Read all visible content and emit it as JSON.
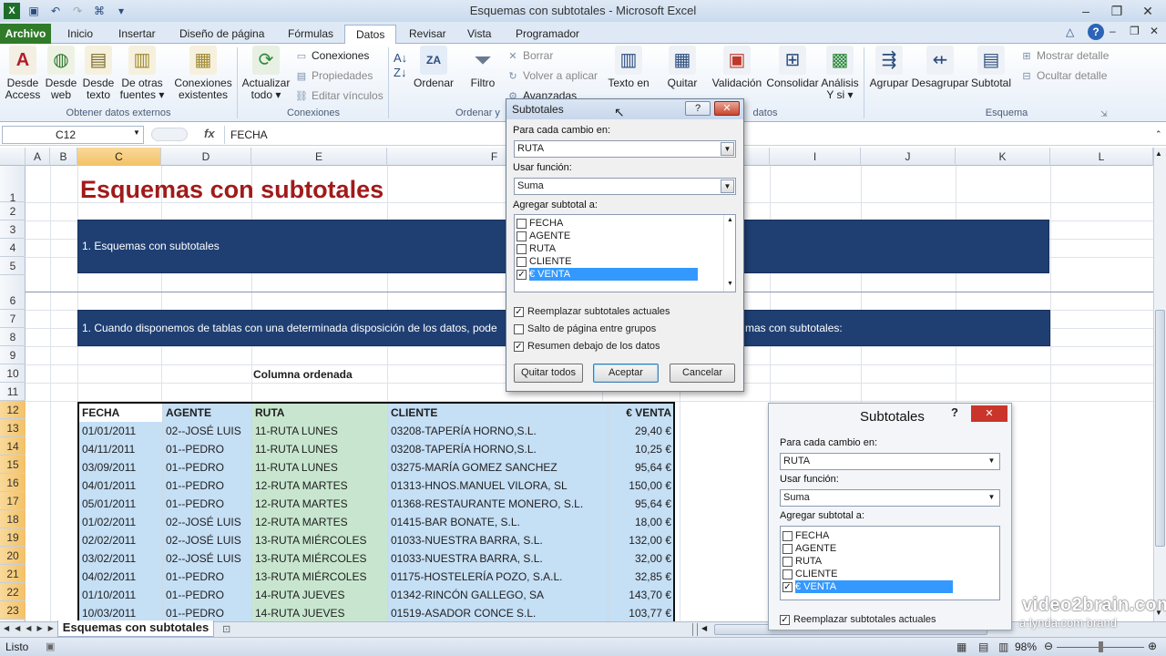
{
  "window": {
    "title": "Esquemas con subtotales - Microsoft Excel"
  },
  "tabs": [
    "Archivo",
    "Inicio",
    "Insertar",
    "Diseño de página",
    "Fórmulas",
    "Datos",
    "Revisar",
    "Vista",
    "Programador"
  ],
  "ribbon": {
    "desde_access": [
      "Desde",
      "Access"
    ],
    "desde_web": [
      "Desde",
      "web"
    ],
    "desde_texto": [
      "Desde",
      "texto"
    ],
    "otras_fuentes": [
      "De otras",
      "fuentes ▾"
    ],
    "conexiones_existentes": [
      "Conexiones",
      "existentes"
    ],
    "group_obtener": "Obtener datos externos",
    "actualizar": [
      "Actualizar",
      "todo ▾"
    ],
    "conexiones": "Conexiones",
    "propiedades": "Propiedades",
    "editar_vinculos": "Editar vínculos",
    "group_conexiones": "Conexiones",
    "ordenar": "Ordenar",
    "filtro": "Filtro",
    "borrar": "Borrar",
    "volver_aplicar": "Volver a aplicar",
    "avanzadas": "Avanzadas",
    "group_ordenar": "Ordenar y",
    "texto_en": "Texto en",
    "quitar": "Quitar",
    "validacion": "Validación",
    "consolidar": "Consolidar",
    "analisis": [
      "Análisis",
      "Y si ▾"
    ],
    "group_datos": "datos",
    "agrupar": "Agrupar",
    "desagrupar": "Desagrupar",
    "subtotal": "Subtotal",
    "mostrar_detalle": "Mostrar detalle",
    "ocultar_detalle": "Ocultar detalle",
    "group_esquema": "Esquema"
  },
  "formula_bar": {
    "cell": "C12",
    "fx": "fx",
    "value": "FECHA"
  },
  "columns": [
    "A",
    "B",
    "C",
    "D",
    "E",
    "F",
    "G",
    "H",
    "I",
    "J",
    "K",
    "L"
  ],
  "rows": [
    "1",
    "2",
    "3",
    "4",
    "5",
    "6",
    "7",
    "8",
    "9",
    "10",
    "11",
    "12",
    "13",
    "14",
    "15",
    "16",
    "17",
    "18",
    "19",
    "20",
    "21",
    "22",
    "23"
  ],
  "sheet": {
    "title": "Esquemas con subtotales",
    "bar1": "1. Esquemas con subtotales",
    "bar2_left": "1. Cuando disponemos de tablas con una determinada disposición de los datos, pode",
    "bar2_right": "mas con subtotales:",
    "columna_ordenada": "Columna ordenada"
  },
  "table": {
    "headers": [
      "FECHA",
      "AGENTE",
      "RUTA",
      "CLIENTE",
      "€ VENTA"
    ],
    "rows": [
      [
        "01/01/2011",
        "02--JOSÉ LUIS",
        "11-RUTA LUNES",
        "03208-TAPERÍA HORNO,S.L.",
        "29,40 €"
      ],
      [
        "04/11/2011",
        "01--PEDRO",
        "11-RUTA LUNES",
        "03208-TAPERÍA HORNO,S.L.",
        "10,25 €"
      ],
      [
        "03/09/2011",
        "01--PEDRO",
        "11-RUTA LUNES",
        "03275-MARÍA GOMEZ SANCHEZ",
        "95,64 €"
      ],
      [
        "04/01/2011",
        "01--PEDRO",
        "12-RUTA MARTES",
        "01313-HNOS.MANUEL VILORA, SL",
        "150,00 €"
      ],
      [
        "05/01/2011",
        "01--PEDRO",
        "12-RUTA MARTES",
        "01368-RESTAURANTE MONERO, S.L.",
        "95,64 €"
      ],
      [
        "01/02/2011",
        "02--JOSÉ LUIS",
        "12-RUTA MARTES",
        "01415-BAR BONATE, S.L.",
        "18,00 €"
      ],
      [
        "02/02/2011",
        "02--JOSÉ LUIS",
        "13-RUTA MIÉRCOLES",
        "01033-NUESTRA BARRA, S.L.",
        "132,00 €"
      ],
      [
        "03/02/2011",
        "02--JOSÉ LUIS",
        "13-RUTA MIÉRCOLES",
        "01033-NUESTRA BARRA, S.L.",
        "32,00 €"
      ],
      [
        "04/02/2011",
        "01--PEDRO",
        "13-RUTA MIÉRCOLES",
        "01175-HOSTELERÍA POZO, S.A.L.",
        "32,85 €"
      ],
      [
        "01/10/2011",
        "01--PEDRO",
        "14-RUTA JUEVES",
        "01342-RINCÓN GALLEGO, SA",
        "143,70 €"
      ],
      [
        "10/03/2011",
        "01--PEDRO",
        "14-RUTA JUEVES",
        "01519-ASADOR CONCE S.L.",
        "103,77 €"
      ]
    ]
  },
  "dialog1": {
    "title": "Subtotales",
    "help": "?",
    "close": "✕",
    "para_cada": "Para cada cambio en:",
    "para_cada_value": "RUTA",
    "usar_funcion": "Usar función:",
    "usar_funcion_value": "Suma",
    "agregar": "Agregar subtotal a:",
    "items": [
      "FECHA",
      "AGENTE",
      "RUTA",
      "CLIENTE",
      "€ VENTA"
    ],
    "opt_reemplazar": "Reemplazar subtotales actuales",
    "opt_salto": "Salto de página entre grupos",
    "opt_resumen": "Resumen debajo de los datos",
    "btn_quitar": "Quitar todos",
    "btn_aceptar": "Aceptar",
    "btn_cancelar": "Cancelar"
  },
  "dialog2": {
    "title": "Subtotales",
    "help": "?",
    "close": "✕",
    "para_cada": "Para cada cambio en:",
    "para_cada_value": "RUTA",
    "usar_funcion": "Usar función:",
    "usar_funcion_value": "Suma",
    "agregar": "Agregar subtotal a:",
    "items": [
      "FECHA",
      "AGENTE",
      "RUTA",
      "CLIENTE",
      "€ VENTA"
    ],
    "opt_reemplazar": "Reemplazar subtotales actuales"
  },
  "sheettab": "Esquemas con subtotales",
  "status": {
    "mode": "Listo",
    "zoom": "98%"
  },
  "watermark": {
    "line1": "video2brain.com",
    "line2": "a lynda.com brand"
  }
}
